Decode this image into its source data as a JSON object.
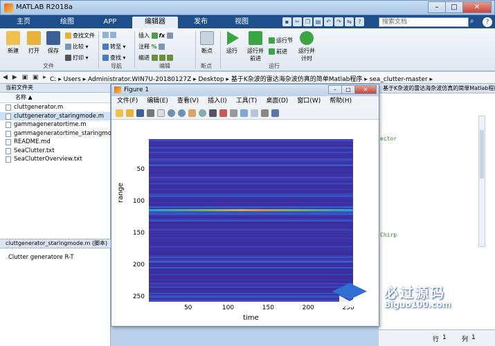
{
  "window": {
    "title": "MATLAB R2018a",
    "minimize": "–",
    "maximize": "□",
    "close": "✕"
  },
  "tabs": [
    "主页",
    "绘图",
    "APP",
    "编辑器",
    "发布",
    "视图"
  ],
  "search": {
    "placeholder": "搜索文档"
  },
  "ribbon": {
    "file": {
      "new": "新建",
      "open": "打开",
      "save": "保存",
      "find_files": "查找文件",
      "compare": "比较",
      "print": "打印",
      "label": "文件"
    },
    "nav": {
      "goto": "转至",
      "find": "查找",
      "label": "导航"
    },
    "edit": {
      "insert": "插入",
      "comment": "注释",
      "indent": "缩进",
      "label": "编辑"
    },
    "breakpoints": {
      "bp": "断点",
      "label": "断点"
    },
    "run": {
      "run": "运行",
      "run_advance": "运行并前进",
      "run_section": "运行节",
      "advance": "前进",
      "run_time": "运行并计时",
      "label": "运行"
    }
  },
  "address": [
    "C:",
    "Users",
    "Administrator.WIN7U-20180127Z",
    "Desktop",
    "基于K杂波的雷达海杂波仿真的简单Matlab程序",
    "sea_clutter-master"
  ],
  "left": {
    "header": "当前文件夹",
    "col": "名称 ▲",
    "files": [
      "cluttgenerator.m",
      "cluttgenerator_staringmode.m",
      "gammageneratortime.m",
      "gammageneratortime_staringmode.m",
      "README.md",
      "SeaClutter.txt",
      "SeaClutterOverview.txt"
    ],
    "detail_header": "cluttgenerator_staringmode.m (脚本)",
    "detail_text": "Clutter generatore R-T"
  },
  "right": {
    "header": "基于K杂波的雷达海杂波仿真的简单Matlab程序\\sea_clutter-mas...",
    "code1": "ector",
    "code2": "Chirp",
    "status_row_label": "行",
    "status_row": "1",
    "status_col_label": "列",
    "status_col": "1"
  },
  "figure": {
    "title": "Figure 1",
    "menu": [
      "文件(F)",
      "编辑(E)",
      "查看(V)",
      "插入(I)",
      "工具(T)",
      "桌面(D)",
      "窗口(W)",
      "帮助(H)"
    ]
  },
  "chart_data": {
    "type": "heatmap",
    "title": "",
    "xlabel": "time",
    "ylabel": "range",
    "xticks": [
      50,
      100,
      150,
      200,
      250
    ],
    "yticks": [
      50,
      100,
      150,
      200,
      250
    ],
    "xlim": [
      1,
      256
    ],
    "ylim": [
      1,
      256
    ],
    "colormap": "parula",
    "bright_row": 112
  },
  "watermark": {
    "main": "必过源码",
    "sub": "Biguo100.com"
  }
}
